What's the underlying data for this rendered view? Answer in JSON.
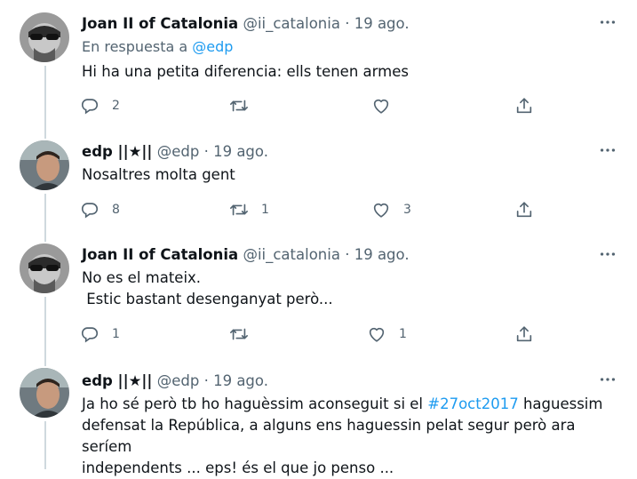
{
  "tweets": [
    {
      "name": "Joan II of Catalonia",
      "handle": "@ii_catalonia",
      "time": "19 ago.",
      "reply_prefix": "En respuesta a",
      "reply_handle": "@edp",
      "text_lines": [
        "Hi ha una petita diferencia: ells tenen armes"
      ],
      "replies": "2",
      "retweets": "",
      "likes": ""
    },
    {
      "name": "edp ||★||",
      "handle": "@edp",
      "time": "19 ago.",
      "text_lines": [
        "Nosaltres molta gent"
      ],
      "replies": "8",
      "retweets": "1",
      "likes": "3"
    },
    {
      "name": "Joan II of Catalonia",
      "handle": "@ii_catalonia",
      "time": "19 ago.",
      "text_lines": [
        "No es el mateix.",
        " Estic bastant desenganyat però..."
      ],
      "replies": "1",
      "retweets": "",
      "likes": "1"
    },
    {
      "name": "edp ||★||",
      "handle": "@edp",
      "time": "19 ago.",
      "text_pre": "Ja ho sé però tb ho haguèssim aconseguit si el ",
      "hashtag": "#27oct2017",
      "text_post": " haguessim",
      "text_lines": [
        "defensat la República, a alguns ens haguessin pelat segur però ara seríem",
        "independents ... eps! és el que jo penso ..."
      ]
    }
  ],
  "separator": "·",
  "icons": {
    "reply": "reply-icon",
    "retweet": "retweet-icon",
    "like": "heart-icon",
    "share": "share-icon",
    "more": "more-icon"
  },
  "colors": {
    "link": "#1d9bf0",
    "secondary": "#536471",
    "text": "#0f1419"
  }
}
